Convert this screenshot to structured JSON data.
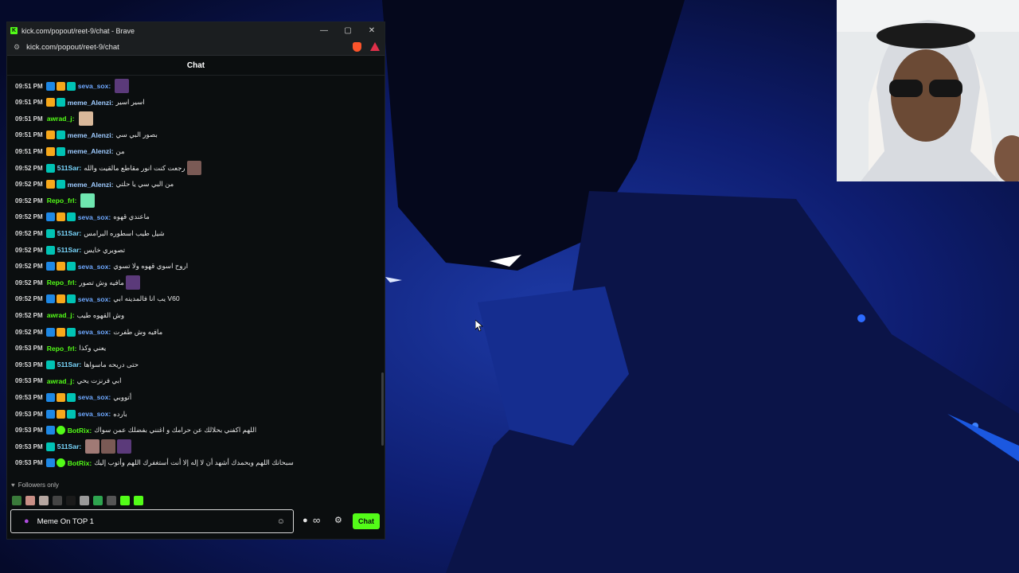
{
  "window": {
    "title": "kick.com/popout/reet-9/chat - Brave",
    "favicon": "K",
    "url": "kick.com/popout/reet-9/chat",
    "controls": {
      "minimize": "—",
      "maximize": "▢",
      "close": "✕"
    }
  },
  "chat": {
    "header": "Chat",
    "messages": [
      {
        "time": "09:51 PM",
        "user": "seva_sox",
        "color": "#6ea8ff",
        "badges": [
          "mod",
          "crown",
          "sub"
        ],
        "text": "",
        "emotes": 1
      },
      {
        "time": "09:51 PM",
        "user": "meme_Alenzi",
        "color": "#9ecbff",
        "badges": [
          "crown",
          "sub"
        ],
        "text": "اسير اسير",
        "emotes": 0
      },
      {
        "time": "09:51 PM",
        "user": "awrad_j",
        "color": "#53fc18",
        "badges": [],
        "text": "",
        "emotes": 1
      },
      {
        "time": "09:51 PM",
        "user": "meme_Alenzi",
        "color": "#9ecbff",
        "badges": [
          "crown",
          "sub"
        ],
        "text": "بصور البي سي",
        "emotes": 0
      },
      {
        "time": "09:51 PM",
        "user": "meme_Alenzi",
        "color": "#9ecbff",
        "badges": [
          "crown",
          "sub"
        ],
        "text": "من",
        "emotes": 0
      },
      {
        "time": "09:52 PM",
        "user": "511Sar",
        "color": "#7ad8ff",
        "badges": [
          "sub"
        ],
        "text": "رجعت كنت انور مقاطع مالقيت والله",
        "emotes": 1
      },
      {
        "time": "09:52 PM",
        "user": "meme_Alenzi",
        "color": "#9ecbff",
        "badges": [
          "crown",
          "sub"
        ],
        "text": "من البي سي يا حلتي",
        "emotes": 0
      },
      {
        "time": "09:52 PM",
        "user": "Repo_frl",
        "color": "#53fc18",
        "badges": [],
        "text": "",
        "emotes": 1
      },
      {
        "time": "09:52 PM",
        "user": "seva_sox",
        "color": "#6ea8ff",
        "badges": [
          "mod",
          "crown",
          "sub"
        ],
        "text": "ماعندي قهوه",
        "emotes": 0
      },
      {
        "time": "09:52 PM",
        "user": "511Sar",
        "color": "#7ad8ff",
        "badges": [
          "sub"
        ],
        "text": "شيل طيب اسطوره البرامس",
        "emotes": 0
      },
      {
        "time": "09:52 PM",
        "user": "511Sar",
        "color": "#7ad8ff",
        "badges": [
          "sub"
        ],
        "text": "تصويري خايس",
        "emotes": 0
      },
      {
        "time": "09:52 PM",
        "user": "seva_sox",
        "color": "#6ea8ff",
        "badges": [
          "mod",
          "crown",
          "sub"
        ],
        "text": "اروح اسوي قهوه ولا تسوي",
        "emotes": 0
      },
      {
        "time": "09:52 PM",
        "user": "Repo_frl",
        "color": "#53fc18",
        "badges": [],
        "text": "مافيه وش تصور",
        "emotes": 1
      },
      {
        "time": "09:52 PM",
        "user": "seva_sox",
        "color": "#6ea8ff",
        "badges": [
          "mod",
          "crown",
          "sub"
        ],
        "text": "V60 يب انا فالمدينه ابي",
        "emotes": 0
      },
      {
        "time": "09:52 PM",
        "user": "awrad_j",
        "color": "#53fc18",
        "badges": [],
        "text": "وش القهوه طيب",
        "emotes": 0
      },
      {
        "time": "09:52 PM",
        "user": "seva_sox",
        "color": "#6ea8ff",
        "badges": [
          "mod",
          "crown",
          "sub"
        ],
        "text": "مافيه وش طفرت",
        "emotes": 0
      },
      {
        "time": "09:53 PM",
        "user": "Repo_frl",
        "color": "#53fc18",
        "badges": [],
        "text": "يعني وكذا",
        "emotes": 0
      },
      {
        "time": "09:53 PM",
        "user": "511Sar",
        "color": "#7ad8ff",
        "badges": [
          "sub"
        ],
        "text": "حتى دريحه ماسواها",
        "emotes": 0
      },
      {
        "time": "09:53 PM",
        "user": "awrad_j",
        "color": "#53fc18",
        "badges": [],
        "text": "ابي فرنزت يحي",
        "emotes": 0
      },
      {
        "time": "09:53 PM",
        "user": "seva_sox",
        "color": "#6ea8ff",
        "badges": [
          "mod",
          "crown",
          "sub"
        ],
        "text": "أتووبي",
        "emotes": 0
      },
      {
        "time": "09:53 PM",
        "user": "seva_sox",
        "color": "#6ea8ff",
        "badges": [
          "mod",
          "crown",
          "sub"
        ],
        "text": "بارده",
        "emotes": 0
      },
      {
        "time": "09:53 PM",
        "user": "BotRix",
        "color": "#53fc18",
        "badges": [
          "mod",
          "bot"
        ],
        "text": "اللهم اكفني بحلالك عن حرامك و اغنني بفضلك عمن سواك",
        "emotes": 0
      },
      {
        "time": "09:53 PM",
        "user": "511Sar",
        "color": "#7ad8ff",
        "badges": [
          "sub"
        ],
        "text": "",
        "emotes": 3
      },
      {
        "time": "09:53 PM",
        "user": "BotRix",
        "color": "#53fc18",
        "badges": [
          "mod",
          "bot"
        ],
        "text": "سبحانك اللهم وبحمدك أشهد أن لا إله إلا أنت أستغفرك اللهم وأتوب إليك",
        "emotes": 0
      }
    ],
    "followers_only": "Followers only",
    "input_value": "Meme On TOP 1",
    "send_label": "Chat",
    "infinity": "∞"
  }
}
